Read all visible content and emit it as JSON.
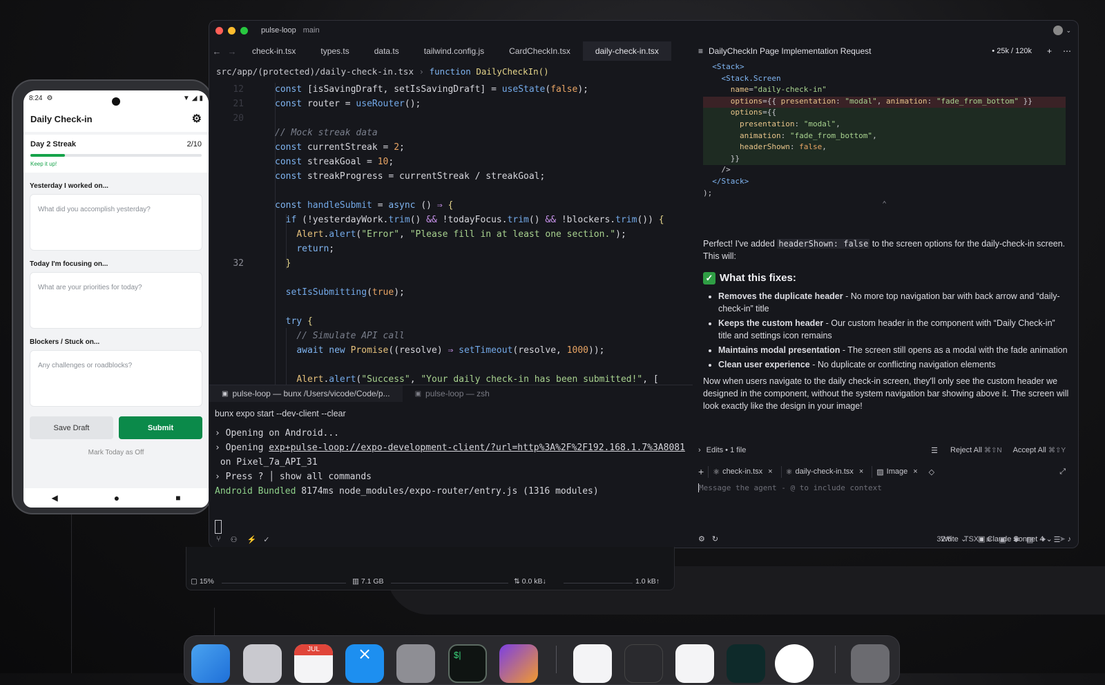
{
  "phone": {
    "time": "8:24",
    "header_title": "Daily Check-in",
    "streak_title": "Day 2 Streak",
    "streak_count": "2/10",
    "streak_progress": 0.2,
    "streak_sub": "Keep it up!",
    "yesterday_label": "Yesterday I worked on...",
    "yesterday_placeholder": "What did you accomplish yesterday?",
    "today_label": "Today I'm focusing on...",
    "today_placeholder": "What are your priorities for today?",
    "blockers_label": "Blockers / Stuck on...",
    "blockers_placeholder": "Any challenges or roadblocks?",
    "save_draft": "Save Draft",
    "submit": "Submit",
    "mark_off": "Mark Today as Off"
  },
  "ide": {
    "project": "pulse-loop",
    "branch": "main",
    "tabs": [
      "check-in.tsx",
      "types.ts",
      "data.ts",
      "tailwind.config.js",
      "CardCheckIn.tsx",
      "daily-check-in.tsx"
    ],
    "breadcrumb_path": "src/app/(protected)/daily-check-in.tsx",
    "breadcrumb_fn_kw": "function",
    "breadcrumb_fn": "DailyCheckIn()",
    "current_line": "32",
    "terminal_tab_1": "pulse-loop — bunx /Users/vicode/Code/p...",
    "terminal_tab_2": "pulse-loop — zsh",
    "terminal_lines": [
      "bunx expo start --dev-client --clear",
      "› Opening on Android...",
      "› Opening ",
      "exp+pulse-loop://expo-development-client/?url=http%3A%2F%2F192.168.1.7%3A8081",
      " on Pixel_7a_API_31",
      "› Press ? │ show all commands",
      "Android Bundled",
      " 8174ms node_modules/expo-router/entry.js (1316 modules)"
    ]
  },
  "agent": {
    "title": "DailyCheckIn Page Implementation Request",
    "tokens": "25k / 120k",
    "intro_1": "Perfect! I've added ",
    "intro_code": "headerShown: false",
    "intro_2": " to the screen options for the daily-check-in screen. This will:",
    "fixes_heading": "What this fixes:",
    "fixes": [
      {
        "bold": "Removes the duplicate header",
        "text": " - No more top navigation bar with back arrow and “daily-check-in” title"
      },
      {
        "bold": "Keeps the custom header",
        "text": " - Our custom header in the component with “Daily Check-in” title and settings icon remains"
      },
      {
        "bold": "Maintains modal presentation",
        "text": " - The screen still opens as a modal with the fade animation"
      },
      {
        "bold": "Clean user experience",
        "text": " - No duplicate or conflicting navigation elements"
      }
    ],
    "outro": "Now when users navigate to the daily check-in screen, they'll only see the custom header we designed in the component, without the system navigation bar showing above it. The screen will look exactly like the design in your image!",
    "edits": "Edits • 1 file",
    "reject_all": "Reject All",
    "reject_shortcut": "⌘⇧N",
    "accept_all": "Accept All",
    "accept_shortcut": "⌘⇧Y",
    "ctx_chip_1": "check-in.tsx",
    "ctx_chip_2": "daily-check-in.tsx",
    "ctx_chip_3": "Image",
    "input_placeholder": "Message the agent - @ to include context",
    "mode": "Write",
    "model": "Claude Sonnet 4"
  },
  "statusbar": {
    "position": "32:6",
    "language": "TSX"
  },
  "monitor": {
    "cpu": "15%",
    "mem": "7.1 GB",
    "net_down": "0.0 kB↓",
    "net_up": "1.0 kB↑"
  },
  "dock": {
    "calendar_month": "JUL"
  }
}
